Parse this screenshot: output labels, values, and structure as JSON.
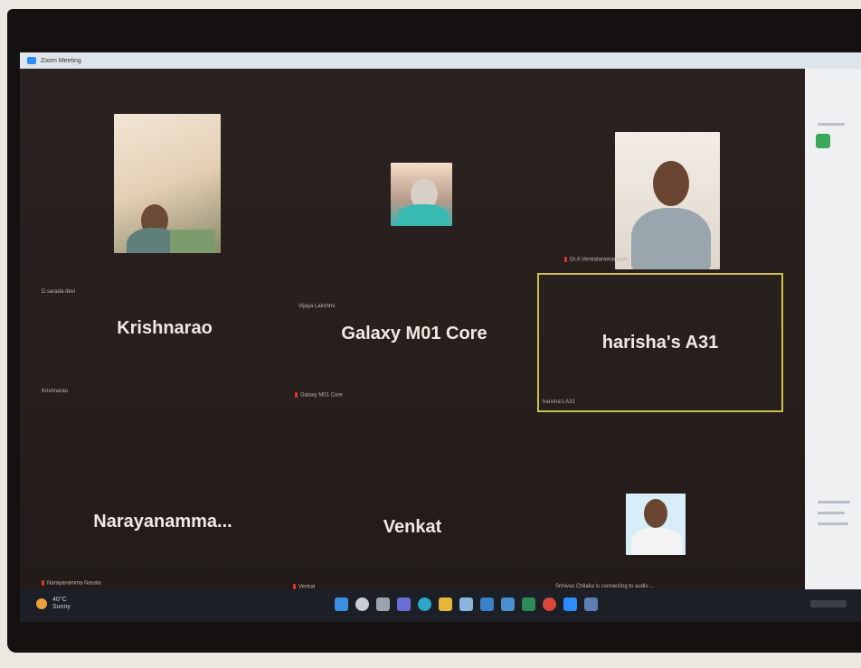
{
  "window": {
    "title": "Zoom Meeting"
  },
  "participants": [
    {
      "id": "p1",
      "label": "D.sarada devi",
      "type": "video",
      "muted": false
    },
    {
      "id": "p2",
      "label": "Vijaya Lakshmi",
      "type": "video",
      "muted": false
    },
    {
      "id": "p3",
      "label": "Dr.A.Venkataramanaiah",
      "type": "video",
      "muted": true
    },
    {
      "id": "p4",
      "label": "Krishnarao",
      "display": "Krishnarao",
      "type": "name",
      "muted": false
    },
    {
      "id": "p5",
      "label": "Galaxy M01 Core",
      "display": "Galaxy M01 Core",
      "type": "name",
      "muted": true
    },
    {
      "id": "p6",
      "label": "harisha's A31",
      "display": "harisha's A31",
      "type": "name",
      "muted": false,
      "active_speaker": true
    },
    {
      "id": "p7",
      "label": "Narayanamma Nasala",
      "display": "Narayanamma...",
      "type": "name",
      "muted": true
    },
    {
      "id": "p8",
      "label": "Venkat",
      "display": "Venkat",
      "type": "name",
      "muted": true
    },
    {
      "id": "p9",
      "label": "Srinivas Chilaka is connecting to audio ...",
      "type": "photo",
      "muted": false
    }
  ],
  "taskbar": {
    "weather_temp": "40°C",
    "weather_desc": "Sunny",
    "icons": [
      "windows-start-icon",
      "search-icon",
      "task-view-icon",
      "chat-icon",
      "edge-icon",
      "file-explorer-icon",
      "store-icon",
      "mail-icon",
      "photos-icon",
      "excel-icon",
      "chrome-icon",
      "zoom-icon",
      "app-icon"
    ]
  },
  "colors": {
    "active_speaker_border": "#c9c14a",
    "muted": "#e0352b",
    "stage": "#261f1c"
  }
}
